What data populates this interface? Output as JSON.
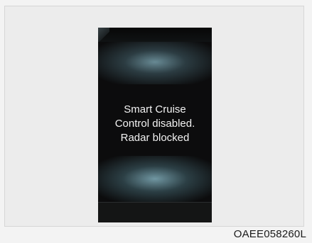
{
  "display": {
    "message_lines": [
      "Smart Cruise",
      "Control disabled.",
      "Radar blocked"
    ]
  },
  "figure_code": "OAEE058260L",
  "colors": {
    "screen_background": "#0c0c0d",
    "glow": "#82afbc",
    "message_text": "#f2f2f2",
    "page_background": "#f3f3f3"
  }
}
